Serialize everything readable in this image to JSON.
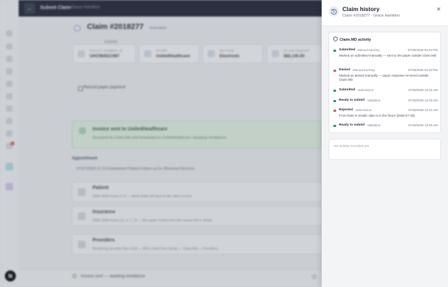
{
  "app": {
    "topbar": {
      "title": "Submit Claim",
      "patient": "Grace Hamilton"
    },
    "rail_avatar": "N",
    "claim": {
      "title": "Claim #2018277",
      "status": "Submitted",
      "eligibility": "Eligibility"
    },
    "stats": [
      {
        "label": "POLICY NUMBER ID",
        "value": "UHC984521987"
      },
      {
        "label": "PAYER",
        "value": "UnitedHealthcare"
      },
      {
        "label": "METHOD",
        "value": "Electronic"
      },
      {
        "label": "CLAIM AMOUNT",
        "value": "$82,140.00"
      }
    ],
    "record_payment": "Record payer payment",
    "invoice": {
      "title": "Invoice sent to UnitedHealthcare",
      "subtitle": "Accepted by Claim.MD and forwarded to UnitedHealthcare. Awaiting remittance."
    },
    "appointment": {
      "heading": "Appointment",
      "line": "07/27/2026 11:15 Established Patient Follow-up  Dr. Bhuemal Rechura"
    },
    "sections": [
      {
        "title": "Patient",
        "subtitle": "CMS-1500 boxes 2–6 — blank fields fall back to the client record"
      },
      {
        "title": "Insurance",
        "subtitle": "CMS-1500 boxes 1a, 4, 7, 11 — the payer comes from the insurer list in Setup"
      },
      {
        "title": "Providers",
        "subtitle": "Rendering provider (box 24J) — NPIs come from Setup — Claim.MD — Providers"
      }
    ],
    "footer": "Invoice sent — awaiting remittance"
  },
  "drawer": {
    "title": "Claim history",
    "subtitle": "Claim #2018277 · Grace Hamilton",
    "activity": {
      "heading": "Claim.MD activity",
      "entries": [
        {
          "status": "Submitted",
          "source": "Manual tracking",
          "time": "07/30/2026 04:34 PM",
          "dot": "#1f8a5b",
          "message": "Marked as submitted manually — sent to the payer outside Claim.MD"
        },
        {
          "status": "Denied",
          "source": "Manual tracking",
          "time": "07/30/2026 04:34 PM",
          "dot": "#d64545",
          "message": "Marked as denied manually — payer response received outside Claim.MD"
        },
        {
          "status": "Submitted",
          "source": "Submission",
          "time": "07/30/2026 12:43 AM",
          "dot": "#1f8a5b",
          "message": ""
        },
        {
          "status": "Ready to submit",
          "source": "Validation",
          "time": "07/30/2026 12:43 AM",
          "dot": "#1f8a5b",
          "message": ""
        },
        {
          "status": "Rejected",
          "source": "Submission",
          "time": "07/30/2026 12:41 AM",
          "dot": "#d64545",
          "message": "From Date is invalid, date is in the future [2026-07-30]."
        },
        {
          "status": "Ready to submit",
          "source": "Validation",
          "time": "07/30/2026 12:33 AM",
          "dot": "#1f8a5b",
          "message": ""
        }
      ]
    },
    "empty_message": "No activity recorded yet."
  }
}
